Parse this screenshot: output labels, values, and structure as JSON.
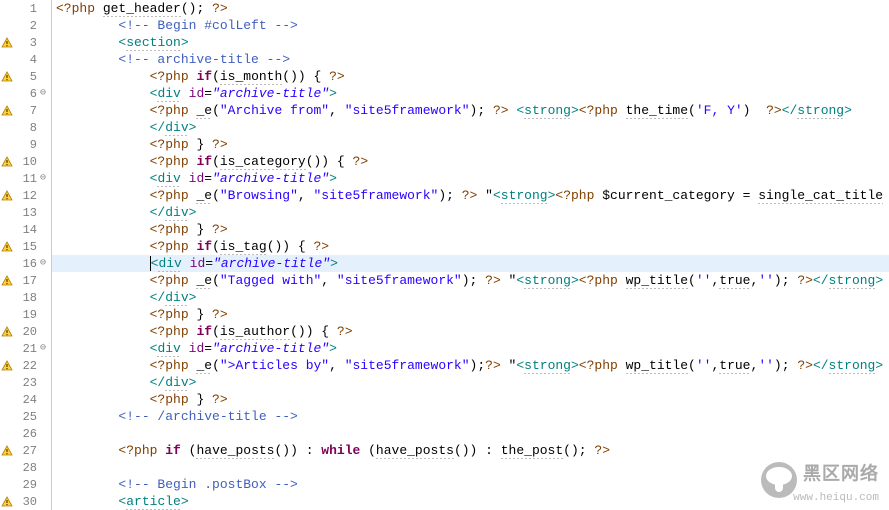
{
  "lines": [
    {
      "n": 1,
      "warn": false,
      "fold": "",
      "code": "<?php get_header(); ?>"
    },
    {
      "n": 2,
      "warn": false,
      "fold": "",
      "code": "        <!-- Begin #colLeft -->"
    },
    {
      "n": 3,
      "warn": true,
      "fold": "",
      "code": "        <section>"
    },
    {
      "n": 4,
      "warn": false,
      "fold": "",
      "code": "        <!-- archive-title -->"
    },
    {
      "n": 5,
      "warn": true,
      "fold": "",
      "code": "            <?php if(is_month()) { ?>"
    },
    {
      "n": 6,
      "warn": false,
      "fold": "⊖",
      "code": "            <div id=\"archive-title\">"
    },
    {
      "n": 7,
      "warn": true,
      "fold": "",
      "code": "            <?php _e(\"Archive from\", \"site5framework\"); ?> <strong><?php the_time('F, Y')  ?></strong>"
    },
    {
      "n": 8,
      "warn": false,
      "fold": "",
      "code": "            </div>"
    },
    {
      "n": 9,
      "warn": false,
      "fold": "",
      "code": "            <?php } ?>"
    },
    {
      "n": 10,
      "warn": true,
      "fold": "",
      "code": "            <?php if(is_category()) { ?>"
    },
    {
      "n": 11,
      "warn": false,
      "fold": "⊖",
      "code": "            <div id=\"archive-title\">"
    },
    {
      "n": 12,
      "warn": true,
      "fold": "",
      "code": "            <?php _e(\"Browsing\", \"site5framework\"); ?> \"<strong><?php $current_category = single_cat_title"
    },
    {
      "n": 13,
      "warn": false,
      "fold": "",
      "code": "            </div>"
    },
    {
      "n": 14,
      "warn": false,
      "fold": "",
      "code": "            <?php } ?>"
    },
    {
      "n": 15,
      "warn": true,
      "fold": "",
      "code": "            <?php if(is_tag()) { ?>"
    },
    {
      "n": 16,
      "warn": false,
      "fold": "⊖",
      "code": "            <div id=\"archive-title\">",
      "highlight": true
    },
    {
      "n": 17,
      "warn": true,
      "fold": "",
      "code": "            <?php _e(\"Tagged with\", \"site5framework\"); ?> \"<strong><?php wp_title('',true,''); ?></strong>"
    },
    {
      "n": 18,
      "warn": false,
      "fold": "",
      "code": "            </div>"
    },
    {
      "n": 19,
      "warn": false,
      "fold": "",
      "code": "            <?php } ?>"
    },
    {
      "n": 20,
      "warn": true,
      "fold": "",
      "code": "            <?php if(is_author()) { ?>"
    },
    {
      "n": 21,
      "warn": false,
      "fold": "⊖",
      "code": "            <div id=\"archive-title\">"
    },
    {
      "n": 22,
      "warn": true,
      "fold": "",
      "code": "            <?php _e(\">Articles by\", \"site5framework\");?> \"<strong><?php wp_title('',true,''); ?></strong>"
    },
    {
      "n": 23,
      "warn": false,
      "fold": "",
      "code": "            </div>"
    },
    {
      "n": 24,
      "warn": false,
      "fold": "",
      "code": "            <?php } ?>"
    },
    {
      "n": 25,
      "warn": false,
      "fold": "",
      "code": "        <!-- /archive-title -->"
    },
    {
      "n": 26,
      "warn": false,
      "fold": "",
      "code": ""
    },
    {
      "n": 27,
      "warn": true,
      "fold": "",
      "code": "        <?php if (have_posts()) : while (have_posts()) : the_post(); ?>"
    },
    {
      "n": 28,
      "warn": false,
      "fold": "",
      "code": ""
    },
    {
      "n": 29,
      "warn": false,
      "fold": "",
      "code": "        <!-- Begin .postBox -->"
    },
    {
      "n": 30,
      "warn": true,
      "fold": "",
      "code": "        <article>"
    }
  ],
  "logo": {
    "title": "黑区网络",
    "url": "www.heiqu.com"
  }
}
